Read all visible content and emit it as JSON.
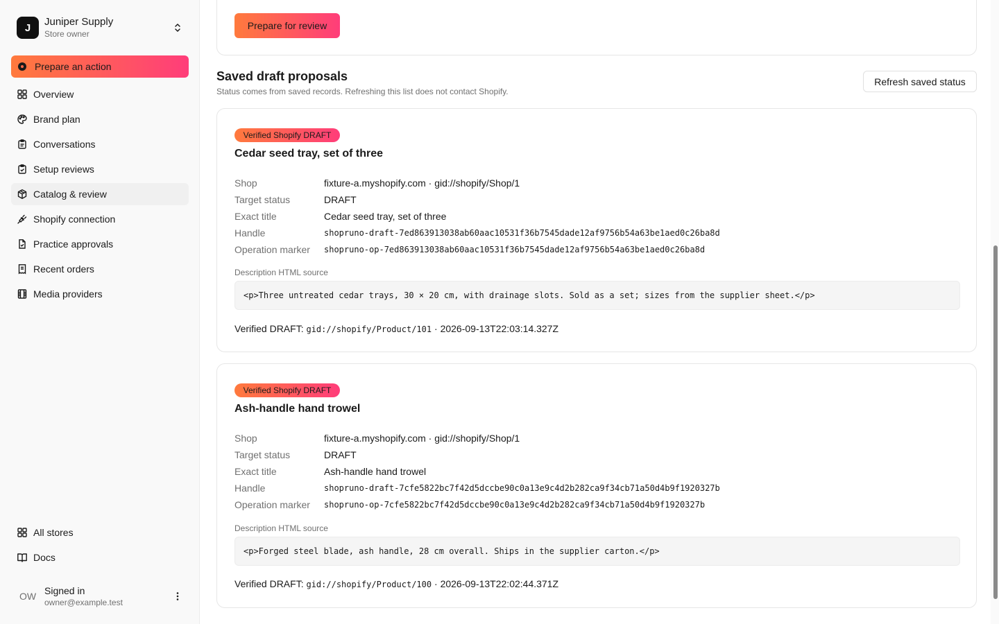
{
  "store": {
    "initial": "J",
    "name": "Juniper Supply",
    "role": "Store owner"
  },
  "cta": {
    "label": "Prepare an action"
  },
  "nav": [
    {
      "label": "Overview",
      "icon": "grid-icon"
    },
    {
      "label": "Brand plan",
      "icon": "palette-icon"
    },
    {
      "label": "Conversations",
      "icon": "clipboard-icon"
    },
    {
      "label": "Setup reviews",
      "icon": "clipboard-check-icon"
    },
    {
      "label": "Catalog & review",
      "icon": "package-icon"
    },
    {
      "label": "Shopify connection",
      "icon": "plug-icon"
    },
    {
      "label": "Practice approvals",
      "icon": "file-check-icon"
    },
    {
      "label": "Recent orders",
      "icon": "receipt-icon"
    },
    {
      "label": "Media providers",
      "icon": "film-icon"
    }
  ],
  "footer_nav": [
    {
      "label": "All stores",
      "icon": "grid-icon"
    },
    {
      "label": "Docs",
      "icon": "book-icon"
    }
  ],
  "user": {
    "initials": "OW",
    "title": "Signed in",
    "email": "owner@example.test"
  },
  "top_card": {
    "button": "Prepare for review"
  },
  "section": {
    "title": "Saved draft proposals",
    "subtitle": "Status comes from saved records. Refreshing this list does not contact Shopify.",
    "refresh_button": "Refresh saved status"
  },
  "labels": {
    "shop": "Shop",
    "target_status": "Target status",
    "exact_title": "Exact title",
    "handle": "Handle",
    "operation_marker": "Operation marker",
    "description_source": "Description HTML source",
    "verified_prefix": "Verified DRAFT:",
    "separator": " · "
  },
  "proposals": [
    {
      "badge": "Verified Shopify DRAFT",
      "title": "Cedar seed tray, set of three",
      "shop": "fixture-a.myshopify.com · gid://shopify/Shop/1",
      "target_status": "DRAFT",
      "exact_title": "Cedar seed tray, set of three",
      "handle": "shopruno-draft-7ed863913038ab60aac10531f36b7545dade12af9756b54a63be1aed0c26ba8d",
      "operation_marker": "shopruno-op-7ed863913038ab60aac10531f36b7545dade12af9756b54a63be1aed0c26ba8d",
      "description": "<p>Three untreated cedar trays, 30 × 20 cm, with drainage slots. Sold as a set; sizes from the supplier sheet.</p>",
      "product_gid": "gid://shopify/Product/101",
      "verified_at": "2026-09-13T22:03:14.327Z"
    },
    {
      "badge": "Verified Shopify DRAFT",
      "title": "Ash-handle hand trowel",
      "shop": "fixture-a.myshopify.com · gid://shopify/Shop/1",
      "target_status": "DRAFT",
      "exact_title": "Ash-handle hand trowel",
      "handle": "shopruno-draft-7cfe5822bc7f42d5dccbe90c0a13e9c4d2b282ca9f34cb71a50d4b9f1920327b",
      "operation_marker": "shopruno-op-7cfe5822bc7f42d5dccbe90c0a13e9c4d2b282ca9f34cb71a50d4b9f1920327b",
      "description": "<p>Forged steel blade, ash handle, 28 cm overall. Ships in the supplier carton.</p>",
      "product_gid": "gid://shopify/Product/100",
      "verified_at": "2026-09-13T22:02:44.371Z"
    }
  ]
}
